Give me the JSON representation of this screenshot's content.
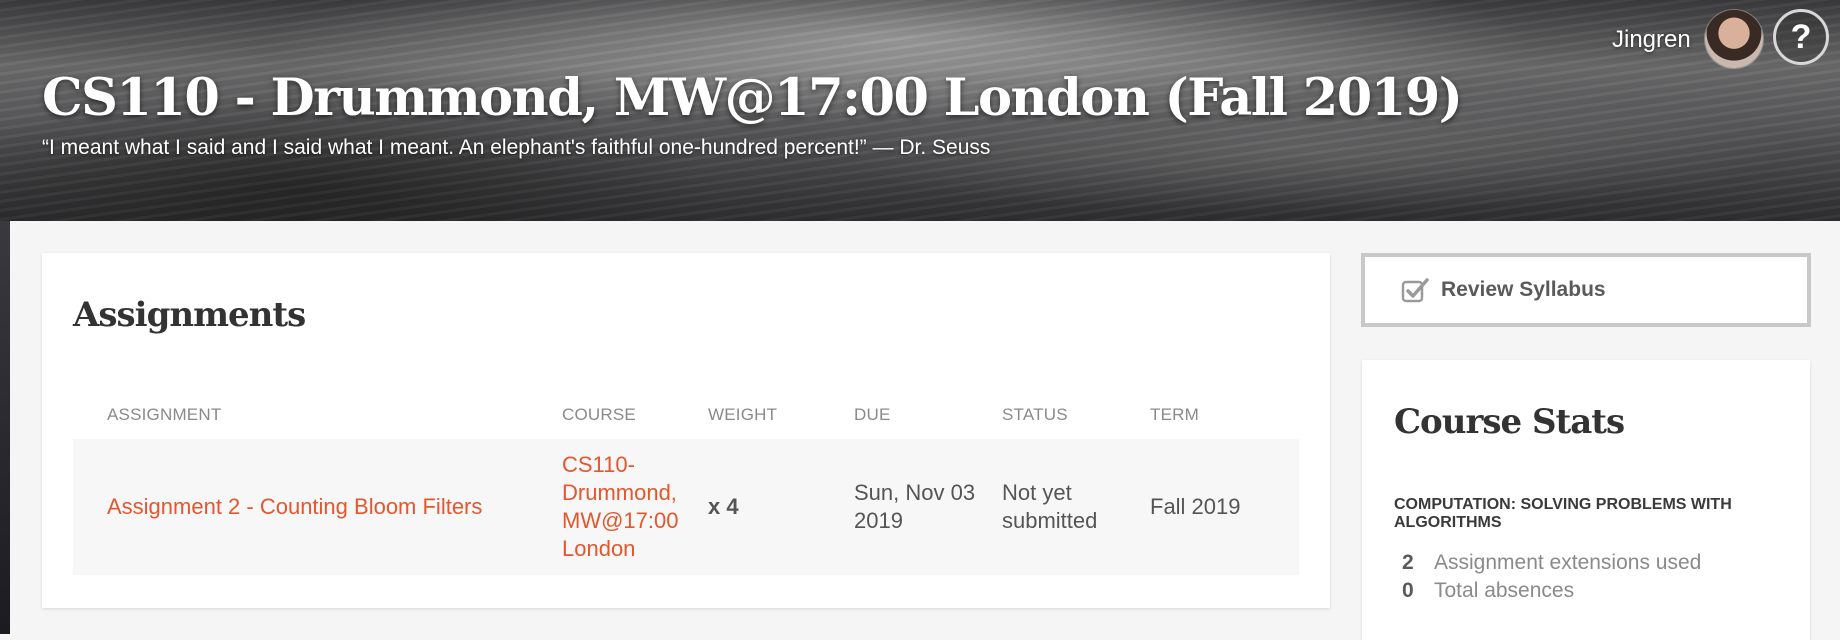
{
  "header": {
    "title": "CS110 - Drummond, MW@17:00 London (Fall 2019)",
    "quote": "“I meant what I said and I said what I meant. An elephant's faithful one-hundred percent!” — Dr. Seuss",
    "user_name": "Jingren",
    "help_label": "?"
  },
  "assignments": {
    "heading": "Assignments",
    "columns": [
      "ASSIGNMENT",
      "COURSE",
      "WEIGHT",
      "DUE",
      "STATUS",
      "TERM"
    ],
    "rows": [
      {
        "assignment": "Assignment 2 - Counting Bloom Filters",
        "course_lines": [
          "CS110-",
          "Drummond,",
          "MW@17:00",
          "London"
        ],
        "weight": "x 4",
        "due_lines": [
          "Sun, Nov 03",
          "2019"
        ],
        "status_lines": [
          "Not yet",
          "submitted"
        ],
        "term": "Fall 2019"
      }
    ]
  },
  "sidebar": {
    "syllabus_label": "Review Syllabus",
    "stats_heading": "Course Stats",
    "course_name": "COMPUTATION: SOLVING PROBLEMS WITH ALGORITHMS",
    "stats": [
      {
        "value": "2",
        "label": "Assignment extensions used"
      },
      {
        "value": "0",
        "label": "Total absences"
      }
    ]
  },
  "colors": {
    "accent": "#e4572e",
    "text": "#3a3a3a",
    "muted": "#8a8a8a"
  },
  "icons": {
    "help": "question-mark-icon",
    "syllabus": "checkbox-icon"
  }
}
